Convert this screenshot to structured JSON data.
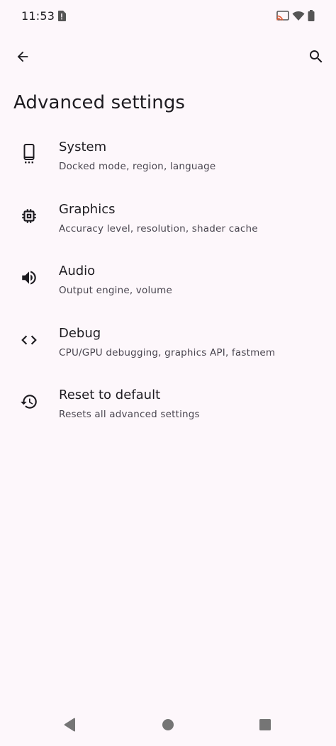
{
  "status_bar": {
    "time": "11:53",
    "icons": [
      "sim-alert-icon",
      "cast-icon",
      "wifi-icon",
      "battery-icon"
    ]
  },
  "toolbar": {
    "back_icon": "arrow-back-icon",
    "search_icon": "search-icon"
  },
  "page": {
    "title": "Advanced settings"
  },
  "settings": [
    {
      "icon": "smartphone-icon",
      "title": "System",
      "subtitle": "Docked mode, region, language"
    },
    {
      "icon": "memory-chip-icon",
      "title": "Graphics",
      "subtitle": "Accuracy level, resolution, shader cache"
    },
    {
      "icon": "volume-icon",
      "title": "Audio",
      "subtitle": "Output engine, volume"
    },
    {
      "icon": "code-icon",
      "title": "Debug",
      "subtitle": "CPU/GPU debugging, graphics API, fastmem"
    },
    {
      "icon": "restore-history-icon",
      "title": "Reset to default",
      "subtitle": "Resets all advanced settings"
    }
  ],
  "nav_bar": {
    "buttons": [
      "nav-back-icon",
      "nav-home-icon",
      "nav-recents-icon"
    ]
  },
  "colors": {
    "background": "#fdf7fb",
    "text_primary": "#1d1b20",
    "text_secondary": "#49454f",
    "cast_accent": "#e4572e",
    "nav_gray": "#757575"
  }
}
